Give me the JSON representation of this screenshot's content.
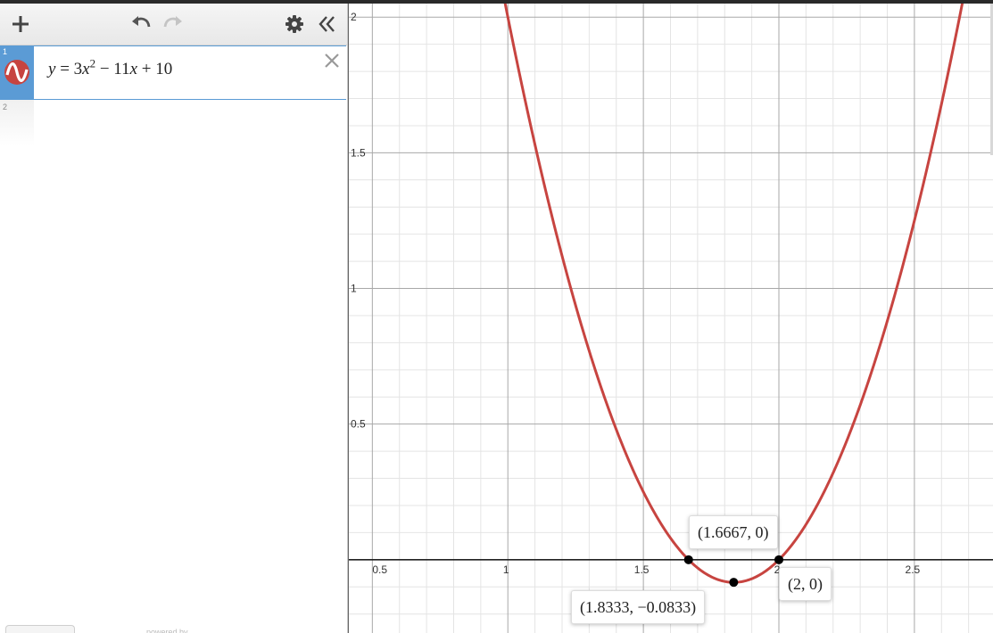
{
  "toolbar": {
    "add_icon": "plus-icon",
    "undo_icon": "undo-icon",
    "redo_icon": "redo-icon",
    "settings_icon": "gear-icon",
    "collapse_icon": "double-chevron-left-icon"
  },
  "expressions": [
    {
      "index": "1",
      "latex": "y = 3x^2 - 11x + 10",
      "color": "#c74440",
      "icon": "graph-wave-icon"
    },
    {
      "index": "2",
      "latex": ""
    }
  ],
  "footer": {
    "powered_by": "powered by"
  },
  "graph": {
    "xlim": [
      0.41,
      2.79
    ],
    "ylim": [
      -0.27,
      2.05
    ],
    "x_ticks": [
      "0.5",
      "1",
      "1.5",
      "2",
      "2.5"
    ],
    "y_ticks": [
      "0.5",
      "1",
      "1.5",
      "2"
    ],
    "curve": {
      "a": 3,
      "b": -11,
      "c": 10,
      "color": "#c74440"
    },
    "points": [
      {
        "x": 1.6667,
        "y": 0,
        "label": "(1.6667, 0)"
      },
      {
        "x": 1.8333,
        "y": -0.0833,
        "label": "(1.8333, −0.0833)"
      },
      {
        "x": 2,
        "y": 0,
        "label": "(2, 0)"
      }
    ]
  }
}
